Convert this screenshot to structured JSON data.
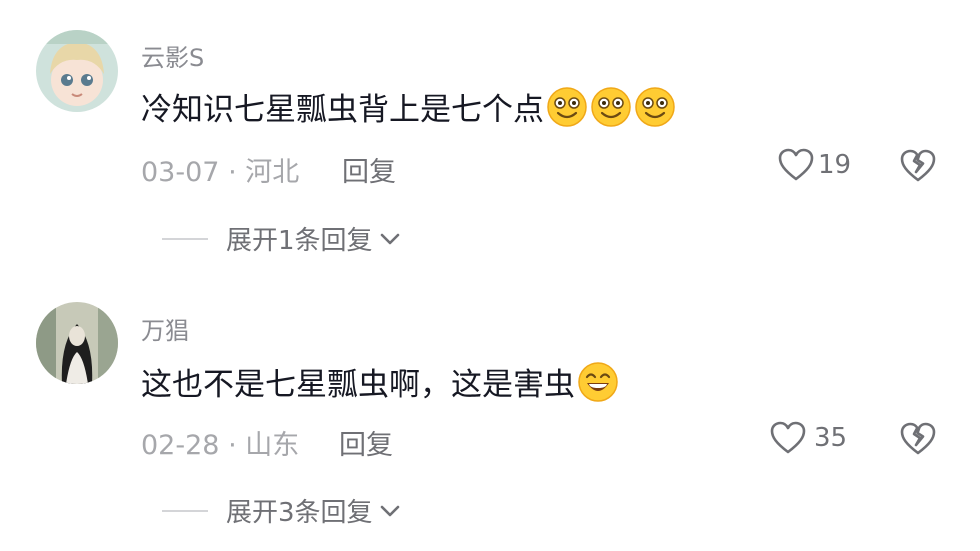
{
  "comments": [
    {
      "username": "云影S",
      "text": "冷知识七星瓢虫背上是七个点",
      "emoji_name": "smile-emoji",
      "emoji_count": 3,
      "date": "03-07",
      "separator": "·",
      "location": "河北",
      "reply_label": "回复",
      "likes": "19",
      "expand_label": "展开1条回复"
    },
    {
      "username": "万猖",
      "text": "这也不是七星瓢虫啊，这是害虫",
      "emoji_name": "grin-emoji",
      "emoji_count": 1,
      "date": "02-28",
      "separator": "·",
      "location": "山东",
      "reply_label": "回复",
      "likes": "35",
      "expand_label": "展开3条回复"
    }
  ],
  "icons": {
    "like": "heart-outline-icon",
    "dislike": "broken-heart-icon",
    "expand": "chevron-down-icon"
  },
  "colors": {
    "username": "#8a8b91",
    "text": "#161823",
    "meta": "#a6a7ab",
    "secondary": "#6f7075",
    "emoji": "#ffcc33"
  }
}
